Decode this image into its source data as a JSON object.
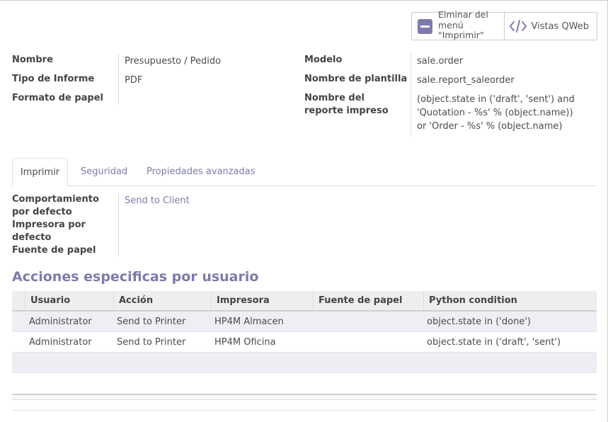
{
  "smart_buttons": {
    "remove_print_menu": "Elminar del\nmenú\n\"Imprimir\"",
    "qweb_views": "Vistas QWeb"
  },
  "left_group": {
    "name_label": "Nombre",
    "name_value": "Presupuesto / Pedido",
    "report_type_label": "Tipo de Informe",
    "report_type_value": "PDF",
    "paper_format_label": "Formato de papel",
    "paper_format_value": ""
  },
  "right_group": {
    "model_label": "Modelo",
    "model_value": "sale.order",
    "template_label": "Nombre de plantilla",
    "template_value": "sale.report_saleorder",
    "print_name_label": "Nombre del reporte impreso",
    "print_name_value": "(object.state in ('draft', 'sent') and 'Quotation - %s' % (object.name)) or 'Order - %s' % (object.name)"
  },
  "tabs": [
    "Imprimir",
    "Seguridad",
    "Propiedades avanzadas"
  ],
  "print_tab": {
    "default_behaviour_label": "Comportamiento por defecto",
    "default_behaviour_value": "Send to Client",
    "default_printer_label": "Impresora por defecto",
    "paper_source_label": "Fuente de papel"
  },
  "section_title": "Acciones especificas por usuario",
  "table": {
    "columns": [
      "Usuario",
      "Acción",
      "Impresora",
      "Fuente de papel",
      "Python condition"
    ],
    "rows": [
      [
        "Administrator",
        "Send to Printer",
        "HP4M Almacen",
        "",
        "object.state in ('done')"
      ],
      [
        "Administrator",
        "Send to Printer",
        "HP4M Oficina",
        "",
        "object.state in ('draft', 'sent')"
      ]
    ]
  },
  "colors": {
    "accent": "#7c7bad",
    "text": "#4c4c4c"
  },
  "icons": [
    "minus-square-icon",
    "code-icon"
  ]
}
